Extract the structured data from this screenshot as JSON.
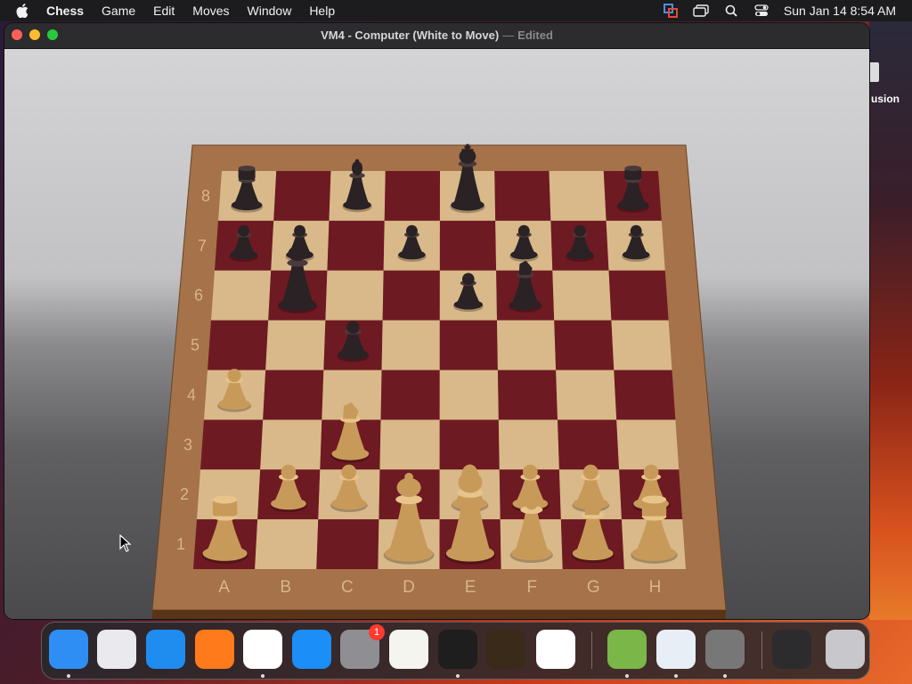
{
  "menubar": {
    "app_name": "Chess",
    "items": [
      "Game",
      "Edit",
      "Moves",
      "Window",
      "Help"
    ],
    "clock": "Sun Jan 14  8:54 AM"
  },
  "desktop": {
    "partial_label": "usion"
  },
  "window": {
    "title": "VM4 - Computer  (White to Move)",
    "separator": "—",
    "status": "Edited"
  },
  "board": {
    "files": [
      "A",
      "B",
      "C",
      "D",
      "E",
      "F",
      "G",
      "H"
    ],
    "ranks": [
      "8",
      "7",
      "6",
      "5",
      "4",
      "3",
      "2",
      "1"
    ],
    "colors": {
      "light": "#d9b98a",
      "dark": "#6e1a22",
      "frame": "#a5724a"
    },
    "pieces": [
      {
        "sq": "a8",
        "c": "b",
        "t": "R"
      },
      {
        "sq": "c8",
        "c": "b",
        "t": "B"
      },
      {
        "sq": "e8",
        "c": "b",
        "t": "K"
      },
      {
        "sq": "h8",
        "c": "b",
        "t": "R"
      },
      {
        "sq": "a7",
        "c": "b",
        "t": "P"
      },
      {
        "sq": "b7",
        "c": "b",
        "t": "P"
      },
      {
        "sq": "d7",
        "c": "b",
        "t": "P"
      },
      {
        "sq": "f7",
        "c": "b",
        "t": "P"
      },
      {
        "sq": "g7",
        "c": "b",
        "t": "P"
      },
      {
        "sq": "h7",
        "c": "b",
        "t": "P"
      },
      {
        "sq": "b6",
        "c": "b",
        "t": "Q"
      },
      {
        "sq": "e6",
        "c": "b",
        "t": "P"
      },
      {
        "sq": "f6",
        "c": "b",
        "t": "N"
      },
      {
        "sq": "c5",
        "c": "b",
        "t": "P"
      },
      {
        "sq": "a4",
        "c": "w",
        "t": "P"
      },
      {
        "sq": "c3",
        "c": "w",
        "t": "N"
      },
      {
        "sq": "b2",
        "c": "w",
        "t": "P"
      },
      {
        "sq": "c2",
        "c": "w",
        "t": "P"
      },
      {
        "sq": "e2",
        "c": "w",
        "t": "P"
      },
      {
        "sq": "f2",
        "c": "w",
        "t": "P"
      },
      {
        "sq": "g2",
        "c": "w",
        "t": "P"
      },
      {
        "sq": "h2",
        "c": "w",
        "t": "P"
      },
      {
        "sq": "a1",
        "c": "w",
        "t": "R"
      },
      {
        "sq": "d1",
        "c": "w",
        "t": "Q"
      },
      {
        "sq": "e1",
        "c": "w",
        "t": "K"
      },
      {
        "sq": "f1",
        "c": "w",
        "t": "B"
      },
      {
        "sq": "g1",
        "c": "w",
        "t": "N"
      },
      {
        "sq": "h1",
        "c": "w",
        "t": "R"
      }
    ]
  },
  "dock": {
    "apps": [
      {
        "name": "finder-icon",
        "color": "#2f8ef4",
        "running": true
      },
      {
        "name": "launchpad-icon",
        "color": "#e9e9ee",
        "running": false
      },
      {
        "name": "safari-icon",
        "color": "#1f8cf0",
        "running": false
      },
      {
        "name": "firefox-icon",
        "color": "#ff7a1a",
        "running": false
      },
      {
        "name": "chrome-icon",
        "color": "#ffffff",
        "running": true
      },
      {
        "name": "app-store-icon",
        "color": "#1b8ef7",
        "running": false
      },
      {
        "name": "system-settings-icon",
        "color": "#8e8e93",
        "running": false,
        "badge": "1"
      },
      {
        "name": "textedit-icon",
        "color": "#f5f5f0",
        "running": false
      },
      {
        "name": "terminal-icon",
        "color": "#1e1e1e",
        "running": true
      },
      {
        "name": "garageband-icon",
        "color": "#3a2a1a",
        "running": false
      },
      {
        "name": "vscode-icon",
        "color": "#ffffff",
        "running": false
      },
      {
        "name": "disk-utility-icon",
        "color": "#7ab648",
        "running": true
      },
      {
        "name": "vmware-icon",
        "color": "#e8eef6",
        "running": true
      },
      {
        "name": "chess-icon",
        "color": "#777777",
        "running": true
      },
      {
        "name": "downloads-stack-icon",
        "color": "#2c2c2e",
        "running": false
      },
      {
        "name": "trash-icon",
        "color": "#c8c8cc",
        "running": false
      }
    ]
  }
}
